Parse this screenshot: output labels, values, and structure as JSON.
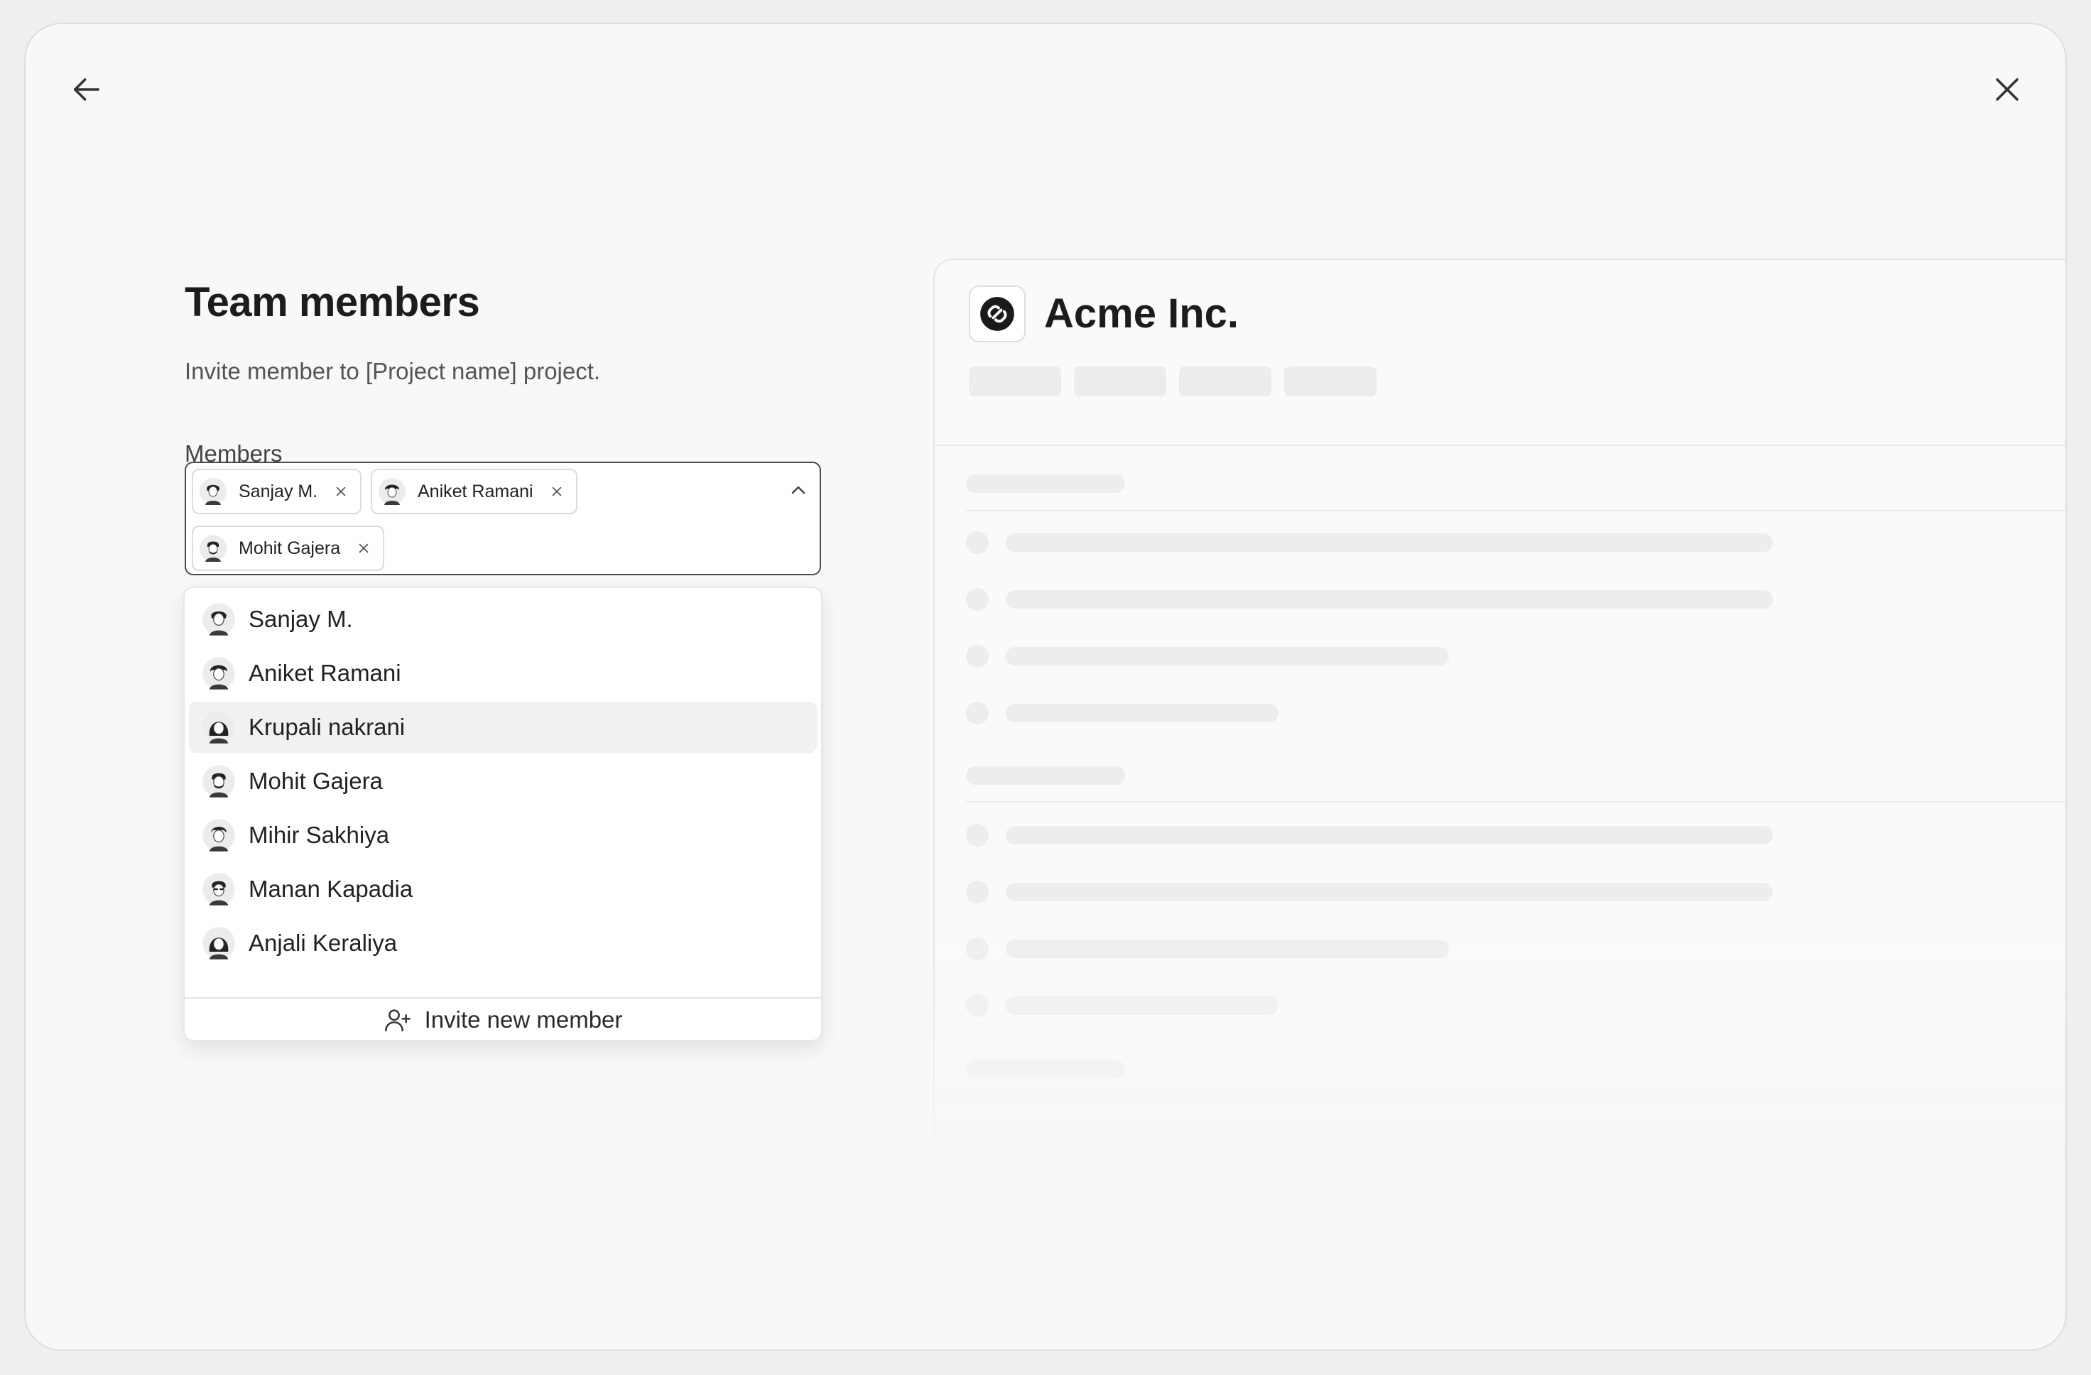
{
  "header": {
    "back_icon": "arrow-left-icon",
    "close_icon": "close-icon"
  },
  "form": {
    "title": "Team members",
    "subtitle": "Invite member to [Project name] project.",
    "members_label": "Members",
    "selected_members": [
      {
        "name": "Sanjay M."
      },
      {
        "name": "Aniket Ramani"
      },
      {
        "name": "Mohit Gajera"
      }
    ]
  },
  "dropdown": {
    "options": [
      {
        "name": "Sanjay M."
      },
      {
        "name": "Aniket Ramani"
      },
      {
        "name": "Krupali nakrani",
        "highlighted": true
      },
      {
        "name": "Mohit Gajera"
      },
      {
        "name": "Mihir Sakhiya"
      },
      {
        "name": "Manan Kapadia"
      },
      {
        "name": "Anjali Keraliya"
      }
    ],
    "invite_label": "Invite new member",
    "invite_icon": "user-plus-icon"
  },
  "preview": {
    "company_name": "Acme Inc.",
    "logo_icon": "acme-logo-icon"
  }
}
